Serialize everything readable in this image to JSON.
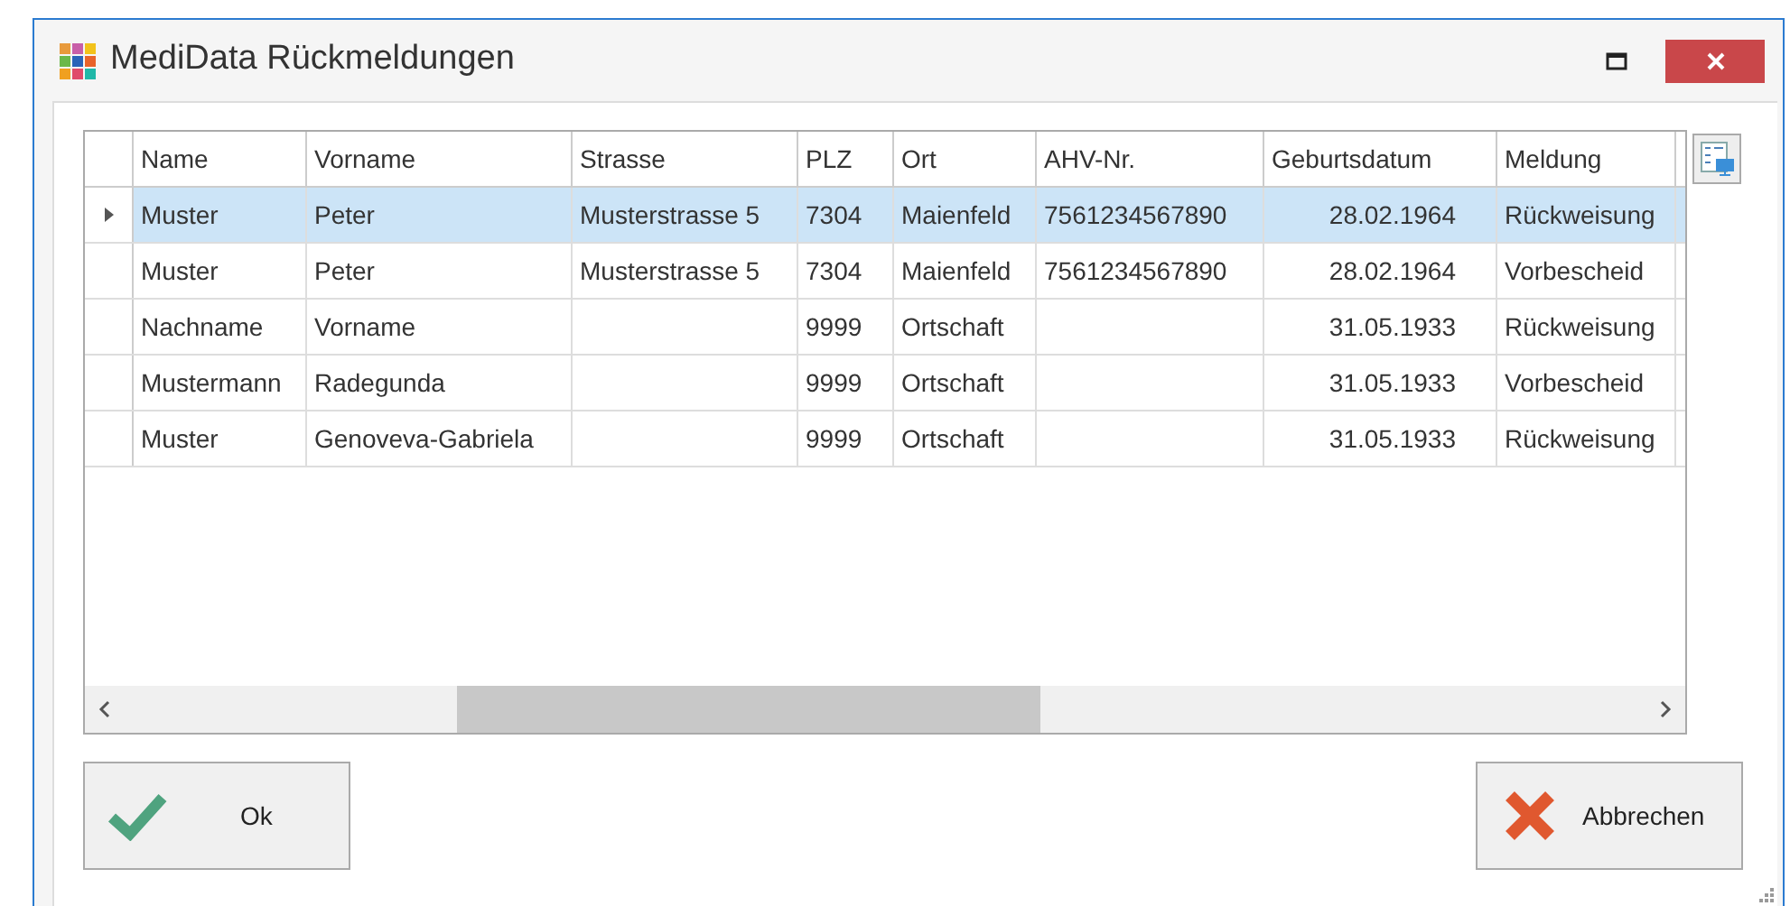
{
  "window": {
    "title": "MediData Rückmeldungen"
  },
  "table": {
    "columns": [
      "Name",
      "Vorname",
      "Strasse",
      "PLZ",
      "Ort",
      "AHV-Nr.",
      "Geburtsdatum",
      "Meldung"
    ],
    "rows": [
      {
        "selected": true,
        "cells": [
          "Muster",
          "Peter",
          "Musterstrasse 5",
          "7304",
          "Maienfeld",
          "7561234567890",
          "28.02.1964",
          "Rückweisung"
        ]
      },
      {
        "selected": false,
        "cells": [
          "Muster",
          "Peter",
          "Musterstrasse 5",
          "7304",
          "Maienfeld",
          "7561234567890",
          "28.02.1964",
          "Vorbescheid"
        ]
      },
      {
        "selected": false,
        "cells": [
          "Nachname",
          "Vorname",
          "",
          "9999",
          "Ortschaft",
          "",
          "31.05.1933",
          "Rückweisung"
        ]
      },
      {
        "selected": false,
        "cells": [
          "Mustermann",
          "Radegunda",
          "",
          "9999",
          "Ortschaft",
          "",
          "31.05.1933",
          "Vorbescheid"
        ]
      },
      {
        "selected": false,
        "cells": [
          "Muster",
          "Genoveva-Gabriela",
          "",
          "9999",
          "Ortschaft",
          "",
          "31.05.1933",
          "Rückweisung"
        ]
      }
    ]
  },
  "buttons": [
    {
      "kind": "ok",
      "label": "Ok"
    },
    {
      "kind": "cancel",
      "label": "Abbrechen"
    }
  ]
}
